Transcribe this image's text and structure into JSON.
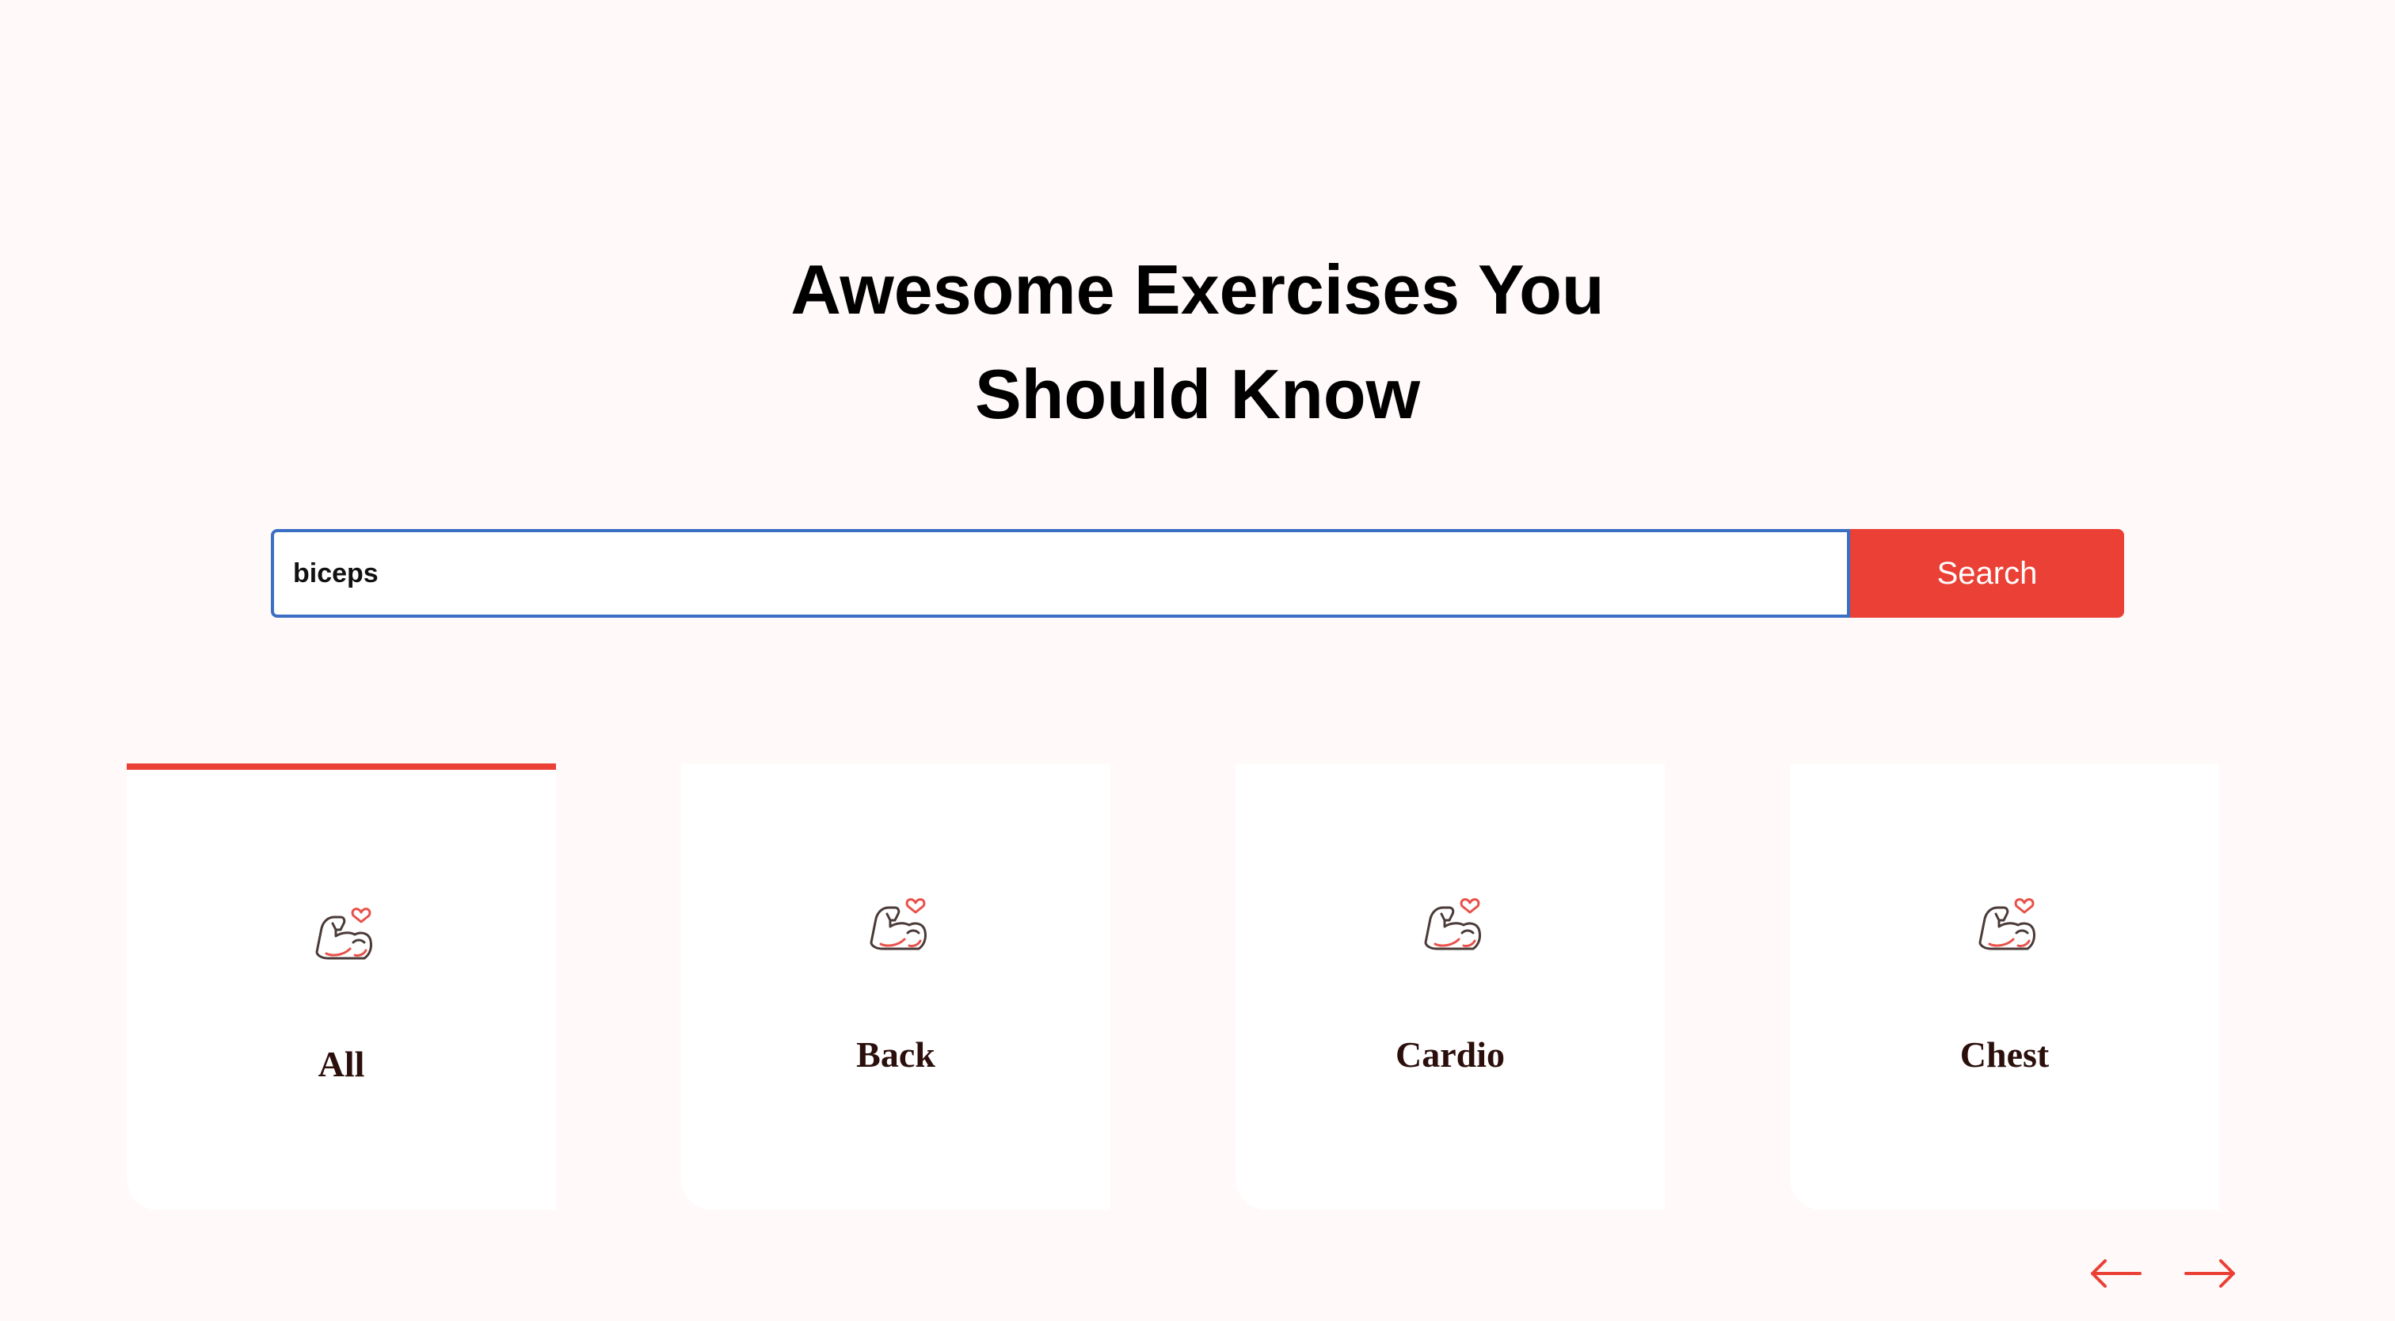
{
  "hero": {
    "title_line1": "Awesome Exercises You",
    "title_line2": "Should Know"
  },
  "search": {
    "value": "biceps",
    "button_label": "Search"
  },
  "categories": [
    {
      "label": "All",
      "icon": "flexed-bicep-heart-icon",
      "active": true
    },
    {
      "label": "Back",
      "icon": "flexed-bicep-heart-icon",
      "active": false
    },
    {
      "label": "Cardio",
      "icon": "flexed-bicep-heart-icon",
      "active": false
    },
    {
      "label": "Chest",
      "icon": "flexed-bicep-heart-icon",
      "active": false
    }
  ],
  "carousel": {
    "prev_icon": "arrow-left-icon",
    "next_icon": "arrow-right-icon"
  },
  "colors": {
    "accent": "#ea4035",
    "page_background": "#fff9f9",
    "card_background": "#ffffff",
    "card_label": "#2b0f0c",
    "input_focus_border": "#3b6fc4"
  }
}
